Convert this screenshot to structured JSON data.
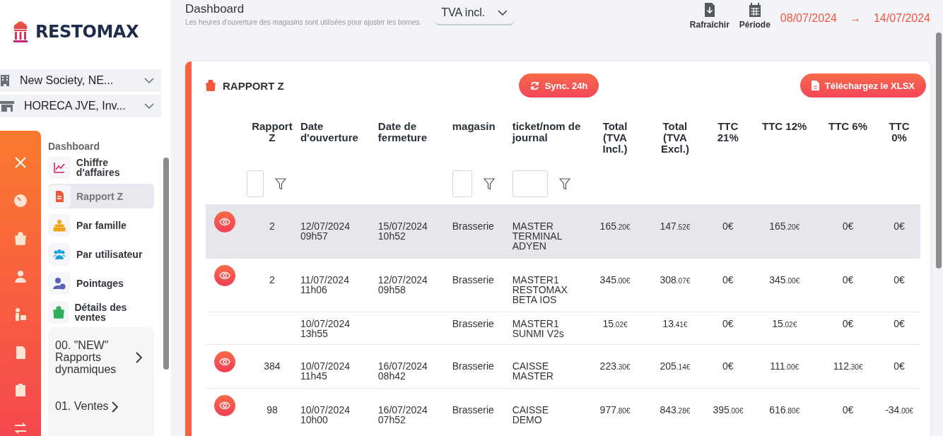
{
  "brand": {
    "name": "RESTOMAX"
  },
  "selectors": [
    {
      "kind": "company",
      "label": "New Society, NE..."
    },
    {
      "kind": "store",
      "label": "HORECA JVE, Inv..."
    }
  ],
  "rail": [
    {
      "kind": "close",
      "selected": false
    },
    {
      "kind": "gauge",
      "selected": false
    },
    {
      "kind": "bag",
      "selected": false
    },
    {
      "kind": "person",
      "selected": false
    },
    {
      "kind": "delivery",
      "selected": false
    },
    {
      "kind": "invoice",
      "selected": false
    },
    {
      "kind": "clipboard",
      "selected": false
    },
    {
      "kind": "transfer",
      "selected": false
    }
  ],
  "menu": {
    "heading": "Dashboard",
    "items": [
      {
        "kind": "chart",
        "label": "Chiffre d'affaires",
        "selected": false
      },
      {
        "kind": "report",
        "label": "Rapport Z",
        "selected": true
      },
      {
        "kind": "hierarchy",
        "label": "Par famille",
        "selected": false
      },
      {
        "kind": "users",
        "label": "Par utilisateur",
        "selected": false
      },
      {
        "kind": "clock-user",
        "label": "Pointages",
        "selected": false
      },
      {
        "kind": "bag",
        "label": "Détails des ventes",
        "selected": false
      }
    ],
    "groups": [
      {
        "label": "00. \"NEW\" Rapports dynamiques"
      },
      {
        "label": "01. Ventes"
      }
    ]
  },
  "header": {
    "title": "Dashboard",
    "subtitle": "Les heures d'ouverture des magasins sont utilisées pour ajuster les bornes.",
    "vat_select": {
      "value": "TVA incl."
    },
    "actions": [
      {
        "kind": "download",
        "label": "Rafraîchir"
      },
      {
        "kind": "calendar",
        "label": "Période"
      }
    ],
    "date_from": "08/07/2024",
    "arrow": "→",
    "date_to": "14/07/2024"
  },
  "card": {
    "title": "RAPPORT Z",
    "sync_button": "Sync. 24h",
    "export_button": "Téléchargez le XLSX",
    "table": {
      "columns": [
        {
          "label": "Rapport Z",
          "filter": true
        },
        {
          "label": "Date d'ouverture",
          "filter": false
        },
        {
          "label": "Date de fermeture",
          "filter": false
        },
        {
          "label": "magasin",
          "filter": true
        },
        {
          "label": "ticket/nom de journal",
          "filter": true
        },
        {
          "label": "Total (TVA Incl.)",
          "filter": false
        },
        {
          "label": "Total (TVA Excl.)",
          "filter": false
        },
        {
          "label": "TTC 21%",
          "filter": false
        },
        {
          "label": "TTC 12%",
          "filter": false
        },
        {
          "label": "TTC 6%",
          "filter": false
        },
        {
          "label": "TTC 0%",
          "filter": false
        }
      ],
      "rows": [
        {
          "selected": true,
          "viewable": true,
          "cells": [
            "2",
            "12/07/2024 09h57",
            "15/07/2024 10h52",
            "Brasserie",
            "MASTER TERMINAL ADYEN",
            "165.20€",
            "147.52€",
            "0€",
            "165.20€",
            "0€",
            "0€"
          ]
        },
        {
          "selected": false,
          "viewable": true,
          "cells": [
            "2",
            "11/07/2024 11h06",
            "12/07/2024 09h58",
            "Brasserie",
            "MASTER1 RESTOMAX BETA IOS",
            "345.00€",
            "308.07€",
            "0€",
            "345.00€",
            "0€",
            "0€"
          ]
        },
        {
          "selected": false,
          "viewable": false,
          "cells": [
            "",
            "10/07/2024 13h55",
            "",
            "Brasserie",
            "MASTER1 SUNMI V2s",
            "15.02€",
            "13.41€",
            "0€",
            "15.02€",
            "0€",
            "0€"
          ]
        },
        {
          "selected": false,
          "viewable": true,
          "cells": [
            "384",
            "10/07/2024 11h45",
            "16/07/2024 08h42",
            "Brasserie",
            "CAISSE MASTER",
            "223.30€",
            "205.14€",
            "0€",
            "111.00€",
            "112.30€",
            "0€"
          ]
        },
        {
          "selected": false,
          "viewable": true,
          "cells": [
            "98",
            "10/07/2024 10h00",
            "16/07/2024 07h52",
            "Brasserie",
            "CAISSE DEMO",
            "977.80€",
            "843.28€",
            "395.00€",
            "616.80€",
            "0€",
            "-34.00€"
          ]
        }
      ]
    }
  }
}
